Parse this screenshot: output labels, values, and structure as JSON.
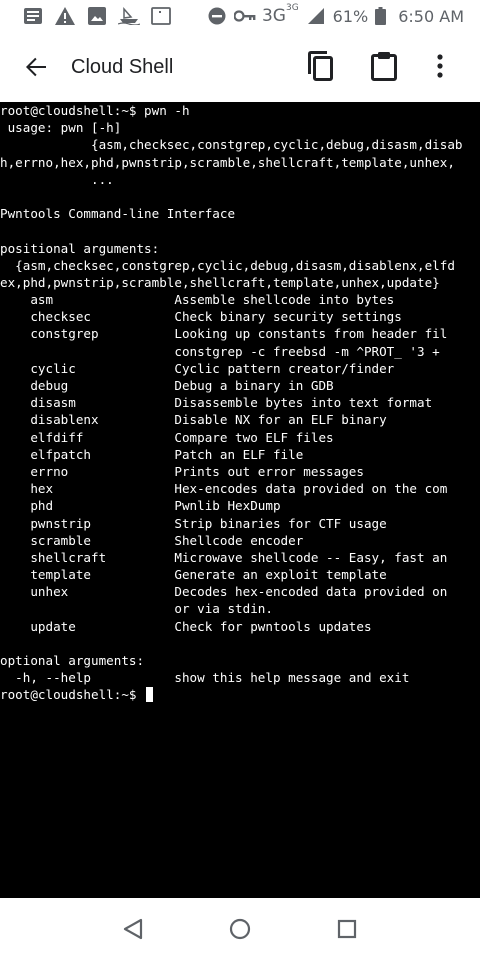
{
  "status_bar": {
    "icons": [
      "news-icon",
      "warning-icon",
      "image-icon",
      "boat-icon",
      "square-icon",
      "dnd-icon",
      "key-icon"
    ],
    "network": "3G",
    "network_sup": "3G",
    "battery": "61%",
    "time": "6:50 AM"
  },
  "app_bar": {
    "title": "Cloud Shell"
  },
  "terminal": {
    "lines": [
      "root@cloudshell:~$ pwn -h",
      " usage: pwn [-h]",
      "            {asm,checksec,constgrep,cyclic,debug,disasm,disab",
      "h,errno,hex,phd,pwnstrip,scramble,shellcraft,template,unhex,",
      "            ...",
      "",
      "Pwntools Command-line Interface",
      "",
      "positional arguments:",
      "  {asm,checksec,constgrep,cyclic,debug,disasm,disablenx,elfd",
      "ex,phd,pwnstrip,scramble,shellcraft,template,unhex,update}",
      "    asm                Assemble shellcode into bytes",
      "    checksec           Check binary security settings",
      "    constgrep          Looking up constants from header fil",
      "                       constgrep -c freebsd -m ^PROT_ '3 +",
      "    cyclic             Cyclic pattern creator/finder",
      "    debug              Debug a binary in GDB",
      "    disasm             Disassemble bytes into text format",
      "    disablenx          Disable NX for an ELF binary",
      "    elfdiff            Compare two ELF files",
      "    elfpatch           Patch an ELF file",
      "    errno              Prints out error messages",
      "    hex                Hex-encodes data provided on the com",
      "    phd                Pwnlib HexDump",
      "    pwnstrip           Strip binaries for CTF usage",
      "    scramble           Shellcode encoder",
      "    shellcraft         Microwave shellcode -- Easy, fast an",
      "    template           Generate an exploit template",
      "    unhex              Decodes hex-encoded data provided on",
      "                       or via stdin.",
      "    update             Check for pwntools updates",
      "",
      "optional arguments:",
      "  -h, --help           show this help message and exit"
    ],
    "prompt": "root@cloudshell:~$ "
  },
  "nav_bar": {
    "buttons": [
      "back-nav-icon",
      "home-nav-icon",
      "recents-nav-icon"
    ]
  }
}
